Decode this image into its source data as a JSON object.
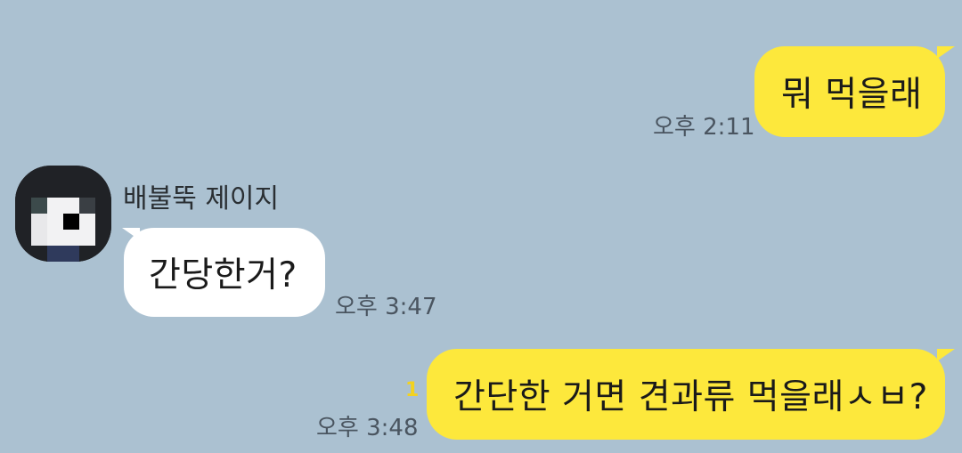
{
  "messages": [
    {
      "direction": "outgoing",
      "text": "뭐 먹을래",
      "time": "오후 2:11"
    },
    {
      "direction": "incoming",
      "sender": "배불뚝 제이지",
      "text": "간당한거?",
      "time": "오후 3:47"
    },
    {
      "direction": "outgoing",
      "text": "간단한 거면 견과류 먹을래ㅅㅂ?",
      "time": "오후 3:48",
      "unread_count": "1"
    }
  ],
  "colors": {
    "background": "#abc1d1",
    "outgoing_bubble": "#fde83c",
    "incoming_bubble": "#ffffff",
    "unread": "#f3d21f"
  },
  "icons": {
    "avatar": "pixelated-profile-avatar"
  }
}
